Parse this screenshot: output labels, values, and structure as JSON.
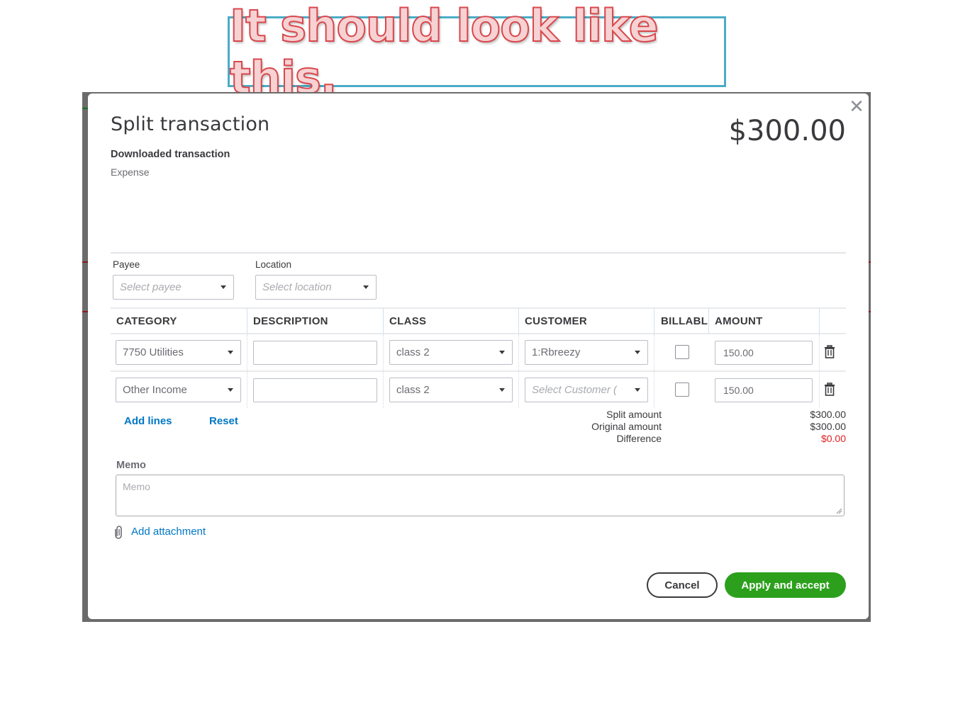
{
  "banner": {
    "text": "It should look like this."
  },
  "modal": {
    "title": "Split transaction",
    "total_amount": "$300.00",
    "close_icon": "close-icon",
    "subtitle": "Downloaded transaction",
    "transaction_type": "Expense"
  },
  "payee": {
    "label": "Payee",
    "placeholder": "Select payee"
  },
  "location": {
    "label": "Location",
    "placeholder": "Select location"
  },
  "table": {
    "columns": [
      "CATEGORY",
      "DESCRIPTION",
      "CLASS",
      "CUSTOMER",
      "BILLABLE",
      "AMOUNT"
    ],
    "rows": [
      {
        "category": "7750 Utilities",
        "description": "",
        "class": "class 2",
        "customer": "1:Rbreezy",
        "customer_placeholder": "",
        "billable": false,
        "amount": "150.00"
      },
      {
        "category": "Other Income",
        "description": "",
        "class": "class 2",
        "customer": "",
        "customer_placeholder": "Select Customer (",
        "billable": false,
        "amount": "150.00"
      }
    ],
    "delete_icon": "trash-icon"
  },
  "actions": {
    "add_lines": "Add lines",
    "reset": "Reset"
  },
  "summary": {
    "split_label": "Split amount",
    "split_value": "$300.00",
    "original_label": "Original amount",
    "original_value": "$300.00",
    "difference_label": "Difference",
    "difference_value": "$0.00",
    "difference_color": "#e02020"
  },
  "memo": {
    "label": "Memo",
    "placeholder": "Memo",
    "value": ""
  },
  "attachment": {
    "label": "Add attachment",
    "icon": "paperclip-icon"
  },
  "footer": {
    "cancel": "Cancel",
    "apply": "Apply and accept",
    "apply_color": "#2ca01c"
  }
}
